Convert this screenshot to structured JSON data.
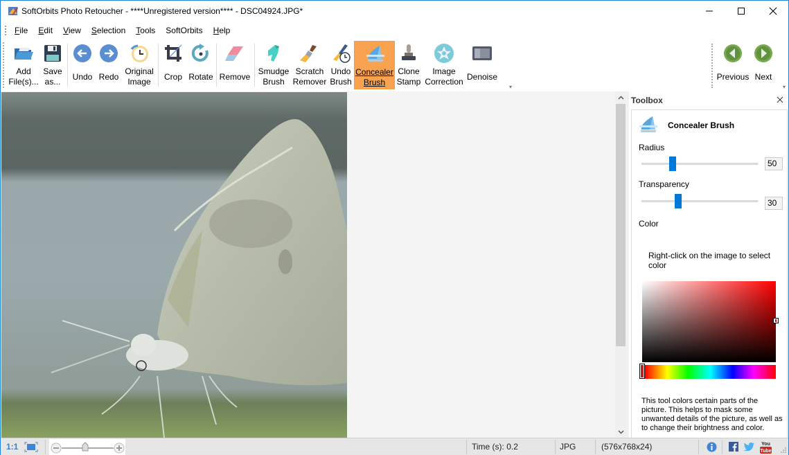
{
  "window": {
    "title": "SoftOrbits Photo Retoucher - ****Unregistered version**** - DSC04924.JPG*",
    "controls": [
      "minimize",
      "maximize",
      "close"
    ]
  },
  "menu": {
    "items": [
      {
        "label": "File",
        "mnemonic": "F",
        "rest": "ile"
      },
      {
        "label": "Edit",
        "mnemonic": "E",
        "rest": "dit"
      },
      {
        "label": "View",
        "mnemonic": "V",
        "rest": "iew"
      },
      {
        "label": "Selection",
        "mnemonic": "S",
        "rest": "election"
      },
      {
        "label": "Tools",
        "mnemonic": "T",
        "rest": "ools"
      },
      {
        "label": "SoftOrbits",
        "mnemonic": "",
        "rest": "SoftOrbits"
      },
      {
        "label": "Help",
        "mnemonic": "H",
        "rest": "elp"
      }
    ]
  },
  "toolbar": {
    "add_files": "Add\nFile(s)...",
    "save_as": "Save\nas...",
    "undo": "Undo",
    "redo": "Redo",
    "original_image": "Original\nImage",
    "crop": "Crop",
    "rotate": "Rotate",
    "remove": "Remove",
    "smudge_brush": "Smudge\nBrush",
    "scratch_remover": "Scratch\nRemover",
    "undo_brush": "Undo\nBrush",
    "concealer_brush": "Concealer\nBrush",
    "clone_stamp": "Clone\nStamp",
    "image_correction": "Image\nCorrection",
    "denoise": "Denoise",
    "previous": "Previous",
    "next": "Next",
    "active_tool": "Concealer Brush",
    "active_color": "#f9a24f"
  },
  "toolbox": {
    "header": "Toolbox",
    "tool_name": "Concealer Brush",
    "radius_label": "Radius",
    "radius_value": "50",
    "radius_fraction": 0.25,
    "transparency_label": "Transparency",
    "transparency_value": "30",
    "transparency_fraction": 0.3,
    "color_label": "Color",
    "color_hint": "Right-click on the image to select color",
    "selected_color": "#ff0000",
    "description": "This tool colors certain parts of the picture. This helps to mask some unwanted details of the picture, as well as to change their brightness and color."
  },
  "statusbar": {
    "ratio_label": "1:1",
    "time": "Time (s): 0.2",
    "format": "JPG",
    "dimensions": "(576x768x24)"
  },
  "accent_color": "#0078d7"
}
